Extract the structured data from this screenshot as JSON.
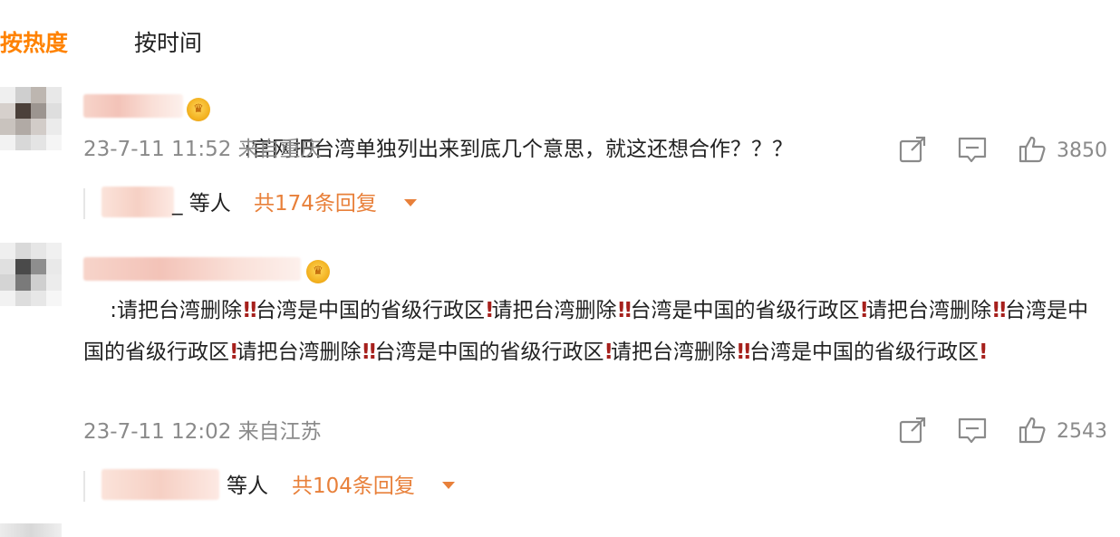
{
  "tabs": {
    "hot_label": "按热度",
    "time_label": "按时间"
  },
  "colors": {
    "accent": "#ff8200",
    "reply_link": "#e8803a",
    "meta": "#8a8a8a",
    "bang": "#a6201c"
  },
  "comments": [
    {
      "separator": ":",
      "text": "官网把台湾单独列出来到底几个意思，就这还想合作？？？",
      "timestamp": "23-7-11 11:52 来自重庆",
      "likes": "3850",
      "reply_suffix": "_ 等人",
      "reply_count": "共174条回复"
    },
    {
      "separator": ":",
      "segments": [
        {
          "t": "请把台湾删除"
        },
        {
          "bang": true
        },
        {
          "bang": true
        },
        {
          "t": "台湾是中国的省级行政区"
        },
        {
          "bang": true
        },
        {
          "t": "请把台湾删除"
        },
        {
          "bang": true
        },
        {
          "bang": true
        },
        {
          "t": "台湾是中国的省级行政区"
        },
        {
          "bang": true
        },
        {
          "t": "请把台湾删除"
        },
        {
          "bang": true
        },
        {
          "bang": true
        },
        {
          "t": "台湾是中国的省级行政区"
        },
        {
          "bang": true
        },
        {
          "t": "请把台湾删除"
        },
        {
          "bang": true
        },
        {
          "bang": true
        },
        {
          "t": "台湾是中国的省级行政区"
        },
        {
          "bang": true
        },
        {
          "t": "请把台湾删除"
        },
        {
          "bang": true
        },
        {
          "bang": true
        },
        {
          "t": "台湾是中国的省级行政区"
        },
        {
          "bang": true
        }
      ],
      "timestamp": "23-7-11 12:02 来自江苏",
      "likes": "2543",
      "reply_suffix": "等人",
      "reply_count": "共104条回复"
    }
  ],
  "icons": {
    "share": "share-icon",
    "comment": "comment-icon",
    "like": "like-icon",
    "badge": "vip-crown-icon",
    "caret": "caret-down-icon",
    "bang": "double-exclamation-icon"
  }
}
